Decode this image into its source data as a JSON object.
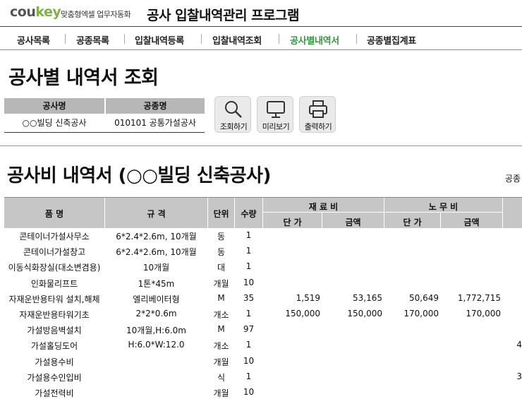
{
  "header": {
    "logo_part1": "cou",
    "logo_part2": "key",
    "tagline": "맞춤형엑셀 업무자동화",
    "title": "공사 입찰내역관리 프로그램"
  },
  "nav": {
    "items": [
      {
        "label": "공사목록"
      },
      {
        "label": "공종목록"
      },
      {
        "label": "입찰내역등록"
      },
      {
        "label": "입찰내역조회"
      },
      {
        "label": "공사별내역서"
      },
      {
        "label": "공종별집계표"
      }
    ],
    "active_index": 4
  },
  "page_title": "공사별 내역서 조회",
  "filter": {
    "col1_header": "공사명",
    "col2_header": "공종명",
    "col1_value": "○○빌딩 신축공사",
    "col2_value": "010101  공통가설공사"
  },
  "buttons": {
    "search": "조회하기",
    "preview": "미리보기",
    "print": "출력하기"
  },
  "section_title": "공사비 내역서 (○○빌딩 신축공사)",
  "right_label": "공종",
  "table": {
    "headers": {
      "name": "품  명",
      "spec": "규  격",
      "unit": "단위",
      "qty": "수량",
      "material": "재 료 비",
      "labor": "노 무 비",
      "unit_price": "단 가",
      "amount": "금액"
    },
    "rows": [
      {
        "name": "콘테이너가설사무소",
        "spec": "6*2.4*2.6m, 10개월",
        "unit": "동",
        "qty": "1",
        "mat_price": "",
        "mat_amount": "",
        "lab_price": "",
        "lab_amount": "",
        "extra": ""
      },
      {
        "name": "콘테이너가설창고",
        "spec": "6*2.4*2.6m, 10개월",
        "unit": "동",
        "qty": "1",
        "mat_price": "",
        "mat_amount": "",
        "lab_price": "",
        "lab_amount": "",
        "extra": ""
      },
      {
        "name": "이동식화장실(대소변겸용)",
        "spec": "10개월",
        "unit": "대",
        "qty": "1",
        "mat_price": "",
        "mat_amount": "",
        "lab_price": "",
        "lab_amount": "",
        "extra": ""
      },
      {
        "name": "인화물리프트",
        "spec": "1톤*45m",
        "unit": "개월",
        "qty": "10",
        "mat_price": "",
        "mat_amount": "",
        "lab_price": "",
        "lab_amount": "",
        "extra": ""
      },
      {
        "name": "자재운반용타워 설치,해체",
        "spec": "엘리베이터형",
        "unit": "M",
        "qty": "35",
        "mat_price": "1,519",
        "mat_amount": "53,165",
        "lab_price": "50,649",
        "lab_amount": "1,772,715",
        "extra": ""
      },
      {
        "name": "자재운반용타워기초",
        "spec": "2*2*0.6m",
        "unit": "개소",
        "qty": "1",
        "mat_price": "150,000",
        "mat_amount": "150,000",
        "lab_price": "170,000",
        "lab_amount": "170,000",
        "extra": ""
      },
      {
        "name": "가설방음벽설치",
        "spec": "10개월,H:6.0m",
        "unit": "M",
        "qty": "97",
        "mat_price": "",
        "mat_amount": "",
        "lab_price": "",
        "lab_amount": "",
        "extra": ""
      },
      {
        "name": "가설홀딩도어",
        "spec": "H:6.0*W:12.0",
        "unit": "개소",
        "qty": "1",
        "mat_price": "",
        "mat_amount": "",
        "lab_price": "",
        "lab_amount": "",
        "extra": "4"
      },
      {
        "name": "가설용수비",
        "spec": "",
        "unit": "개월",
        "qty": "10",
        "mat_price": "",
        "mat_amount": "",
        "lab_price": "",
        "lab_amount": "",
        "extra": ""
      },
      {
        "name": "가설용수인입비",
        "spec": "",
        "unit": "식",
        "qty": "1",
        "mat_price": "",
        "mat_amount": "",
        "lab_price": "",
        "lab_amount": "",
        "extra": "3"
      },
      {
        "name": "가설전력비",
        "spec": "",
        "unit": "개월",
        "qty": "10",
        "mat_price": "",
        "mat_amount": "",
        "lab_price": "",
        "lab_amount": "",
        "extra": ""
      }
    ]
  }
}
